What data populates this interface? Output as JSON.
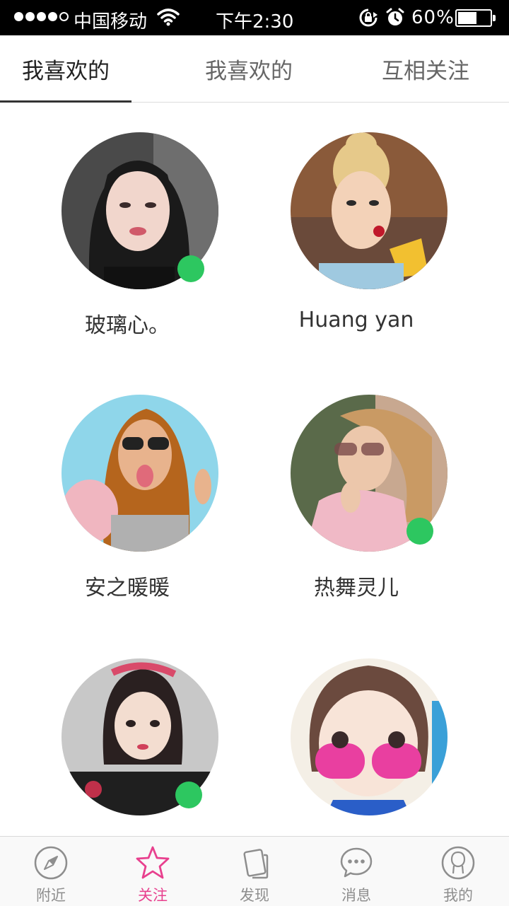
{
  "status_bar": {
    "carrier": "中国移动",
    "time": "下午2:30",
    "battery_percent": "60%",
    "battery_level": 0.6,
    "signal_bars": 4,
    "icons": [
      "wifi-icon",
      "rotation-lock-icon",
      "alarm-icon",
      "battery-icon"
    ]
  },
  "tabs": [
    {
      "label": "我喜欢的",
      "active": true
    },
    {
      "label": "我喜欢的",
      "active": false
    },
    {
      "label": "互相关注",
      "active": false
    }
  ],
  "users": [
    {
      "name": "玻璃心。",
      "online": true
    },
    {
      "name": "Huang yan",
      "online": false
    },
    {
      "name": "安之暖暖",
      "online": false
    },
    {
      "name": "热舞灵儿",
      "online": true
    },
    {
      "name": "",
      "online": true
    },
    {
      "name": "",
      "online": false
    }
  ],
  "bottom_nav": {
    "items": [
      {
        "label": "附近",
        "icon": "compass-icon",
        "active": false
      },
      {
        "label": "关注",
        "icon": "star-icon",
        "active": true
      },
      {
        "label": "发现",
        "icon": "cards-icon",
        "active": false
      },
      {
        "label": "消息",
        "icon": "chat-bubble-icon",
        "active": false
      },
      {
        "label": "我的",
        "icon": "person-icon",
        "active": false
      }
    ]
  },
  "colors": {
    "accent": "#e8408e",
    "online": "#2dc760",
    "inactive": "#8e8e8e",
    "status_bar_bg": "#000000"
  }
}
